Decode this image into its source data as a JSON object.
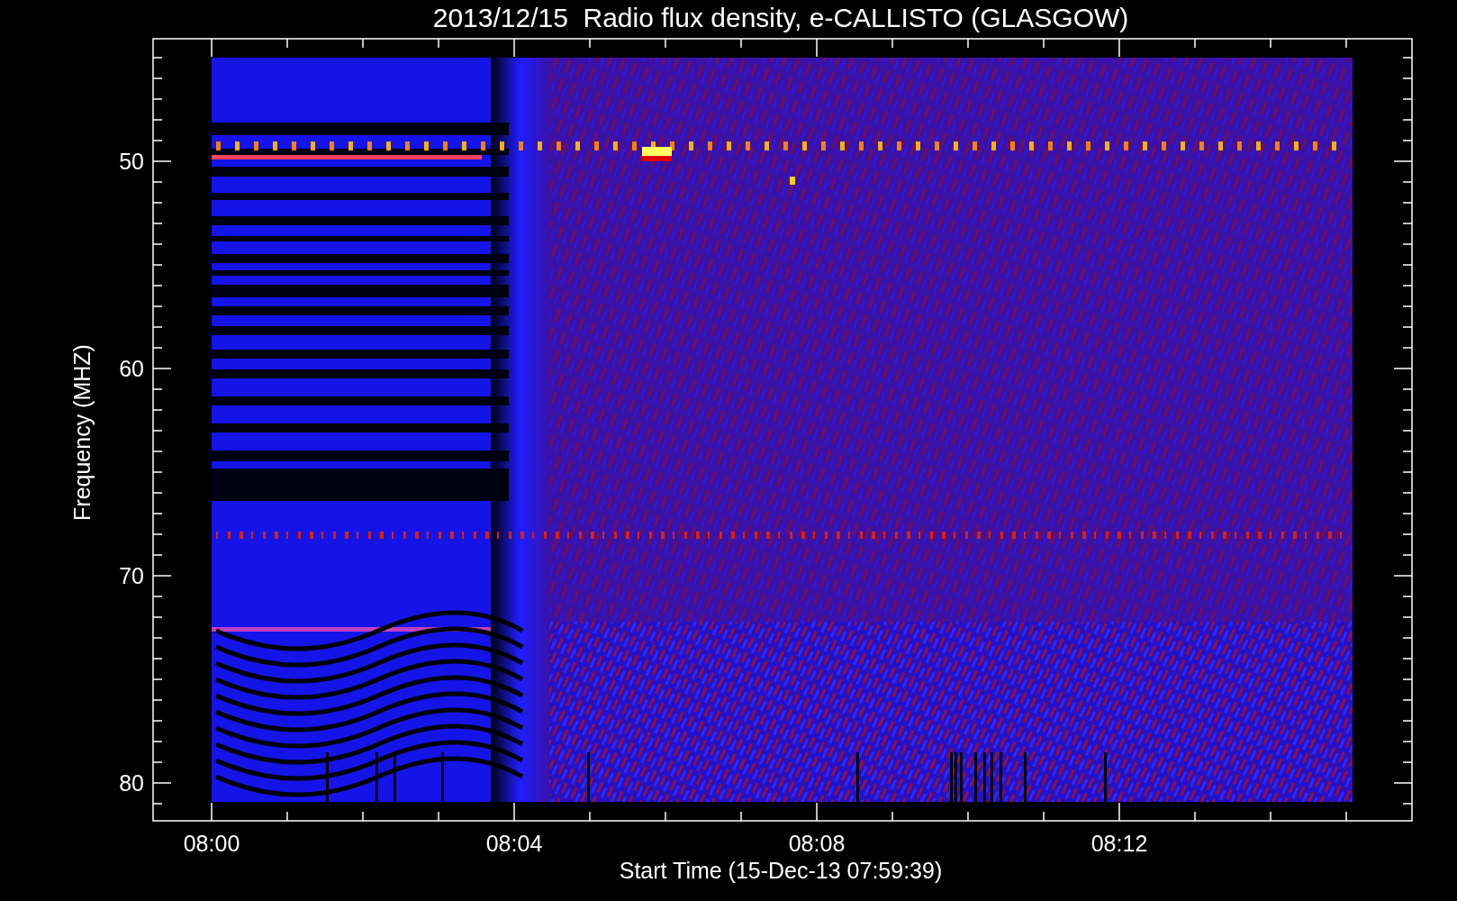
{
  "title": "2013/12/15  Radio flux density, e-CALLISTO (GLASGOW)",
  "y_axis": {
    "label": "Frequency (MHZ)",
    "ticks": [
      "50",
      "60",
      "70",
      "80"
    ]
  },
  "x_axis": {
    "label": "Start Time (15-Dec-13 07:59:39)",
    "ticks": [
      "08:00",
      "08:04",
      "08:08",
      "08:12"
    ]
  }
}
